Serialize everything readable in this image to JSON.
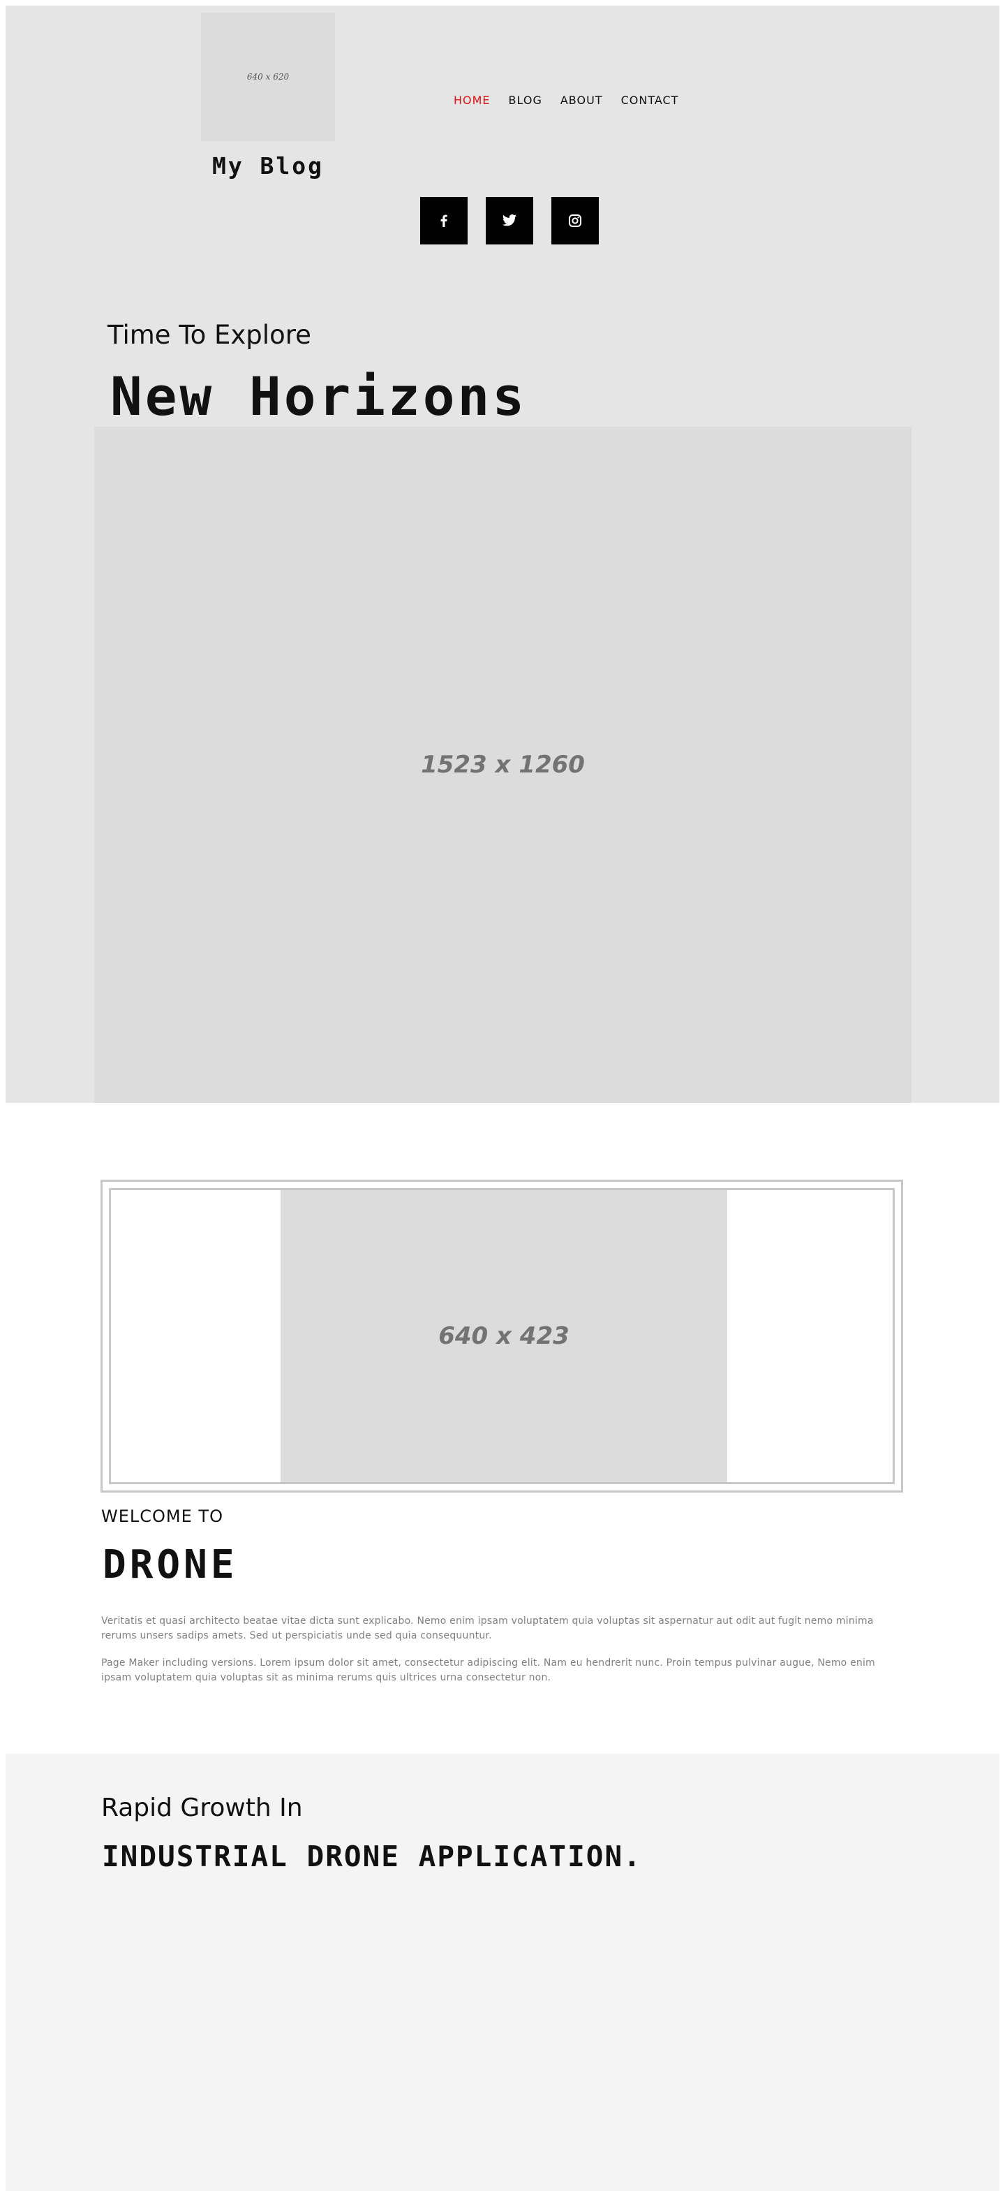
{
  "header": {
    "logo_placeholder": "640 x 620",
    "blog_name": "My Blog",
    "nav": [
      {
        "label": "HOME",
        "active": true
      },
      {
        "label": "BLOG",
        "active": false
      },
      {
        "label": "ABOUT",
        "active": false
      },
      {
        "label": "CONTACT",
        "active": false
      }
    ],
    "social": [
      {
        "icon": "facebook-icon"
      },
      {
        "icon": "twitter-icon"
      },
      {
        "icon": "instagram-icon"
      }
    ],
    "accent_color": "#e01414"
  },
  "hero": {
    "tagline": "Time To Explore",
    "title": "New Horizons",
    "image_placeholder": "1523 x 1260"
  },
  "welcome": {
    "image_placeholder": "640 x 423",
    "subtitle": "WELCOME TO",
    "title": "DRONE",
    "paragraphs": [
      "Veritatis et quasi architecto beatae vitae dicta sunt explicabo. Nemo enim ipsam voluptatem quia voluptas sit aspernatur aut odit aut fugit nemo minima rerums unsers sadips amets. Sed ut perspiciatis unde sed quia consequuntur.",
      "Page Maker including versions. Lorem ipsum dolor sit amet, consectetur adipiscing elit. Nam eu hendrerit nunc. Proin tempus pulvinar augue, Nemo enim ipsam voluptatem quia voluptas sit as minima rerums quis ultrices urna consectetur non."
    ]
  },
  "growth": {
    "subtitle": "Rapid Growth In",
    "title": "INDUSTRIAL DRONE APPLICATION."
  }
}
